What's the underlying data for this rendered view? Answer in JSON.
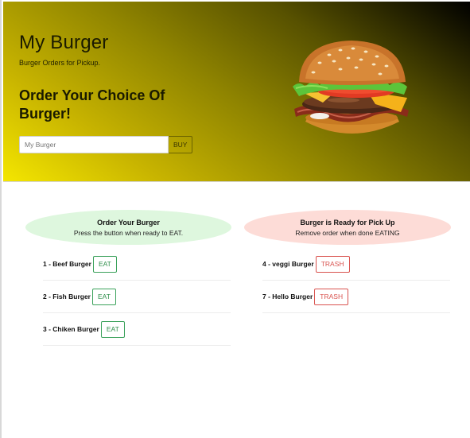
{
  "hero": {
    "title": "My Burger",
    "subtitle": "Burger Orders for Pickup.",
    "heading": "Order Your Choice Of Burger!",
    "input_placeholder": "My Burger",
    "buy_label": "BUY"
  },
  "order_panel": {
    "title": "Order Your Burger",
    "subtitle": "Press the button when ready to EAT.",
    "accent_color": "#def7de",
    "items": [
      {
        "label": "1 - Beef Burger",
        "action": "EAT"
      },
      {
        "label": "2 - Fish Burger",
        "action": "EAT"
      },
      {
        "label": "3 - Chiken Burger",
        "action": "EAT"
      }
    ]
  },
  "ready_panel": {
    "title": "Burger is Ready for Pick Up",
    "subtitle": "Remove order when done EATING",
    "accent_color": "#fddcd7",
    "items": [
      {
        "label": "4 - veggi Burger",
        "action": "TRASH"
      },
      {
        "label": "7 - Hello Burger",
        "action": "TRASH"
      }
    ]
  }
}
